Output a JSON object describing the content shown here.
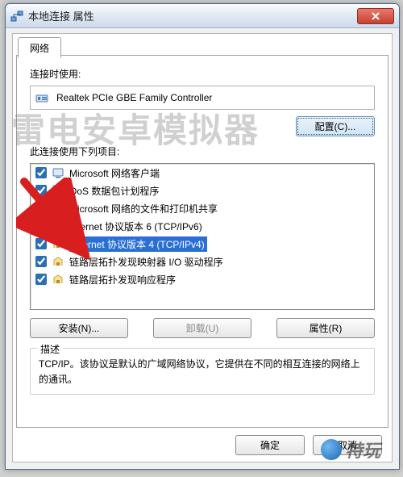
{
  "window": {
    "title": "本地连接 属性"
  },
  "tab": {
    "label": "网络"
  },
  "adapter": {
    "label": "连接时使用:",
    "name": "Realtek PCIe GBE Family Controller",
    "configure_btn": "配置(C)..."
  },
  "items_label": "此连接使用下列项目:",
  "items": [
    {
      "checked": true,
      "icon": "client",
      "label": "Microsoft 网络客户端",
      "selected": false
    },
    {
      "checked": true,
      "icon": "qos",
      "label": "QoS 数据包计划程序",
      "selected": false
    },
    {
      "checked": true,
      "icon": "share",
      "label": "Microsoft 网络的文件和打印机共享",
      "selected": false
    },
    {
      "checked": true,
      "icon": "proto",
      "label": "Internet 协议版本 6 (TCP/IPv6)",
      "selected": false
    },
    {
      "checked": true,
      "icon": "proto",
      "label": "Internet 协议版本 4 (TCP/IPv4)",
      "selected": true
    },
    {
      "checked": true,
      "icon": "proto",
      "label": "链路层拓扑发现映射器 I/O 驱动程序",
      "selected": false
    },
    {
      "checked": true,
      "icon": "proto",
      "label": "链路层拓扑发现响应程序",
      "selected": false
    }
  ],
  "buttons": {
    "install": "安装(N)...",
    "uninstall": "卸载(U)",
    "properties": "属性(R)"
  },
  "description": {
    "title": "描述",
    "text": "TCP/IP。该协议是默认的广域网络协议，它提供在不同的相互连接的网络上的通讯。"
  },
  "dialog": {
    "ok": "确定",
    "cancel": "取消"
  },
  "watermark": "雷电安卓模拟器",
  "site_watermark": "特玩"
}
